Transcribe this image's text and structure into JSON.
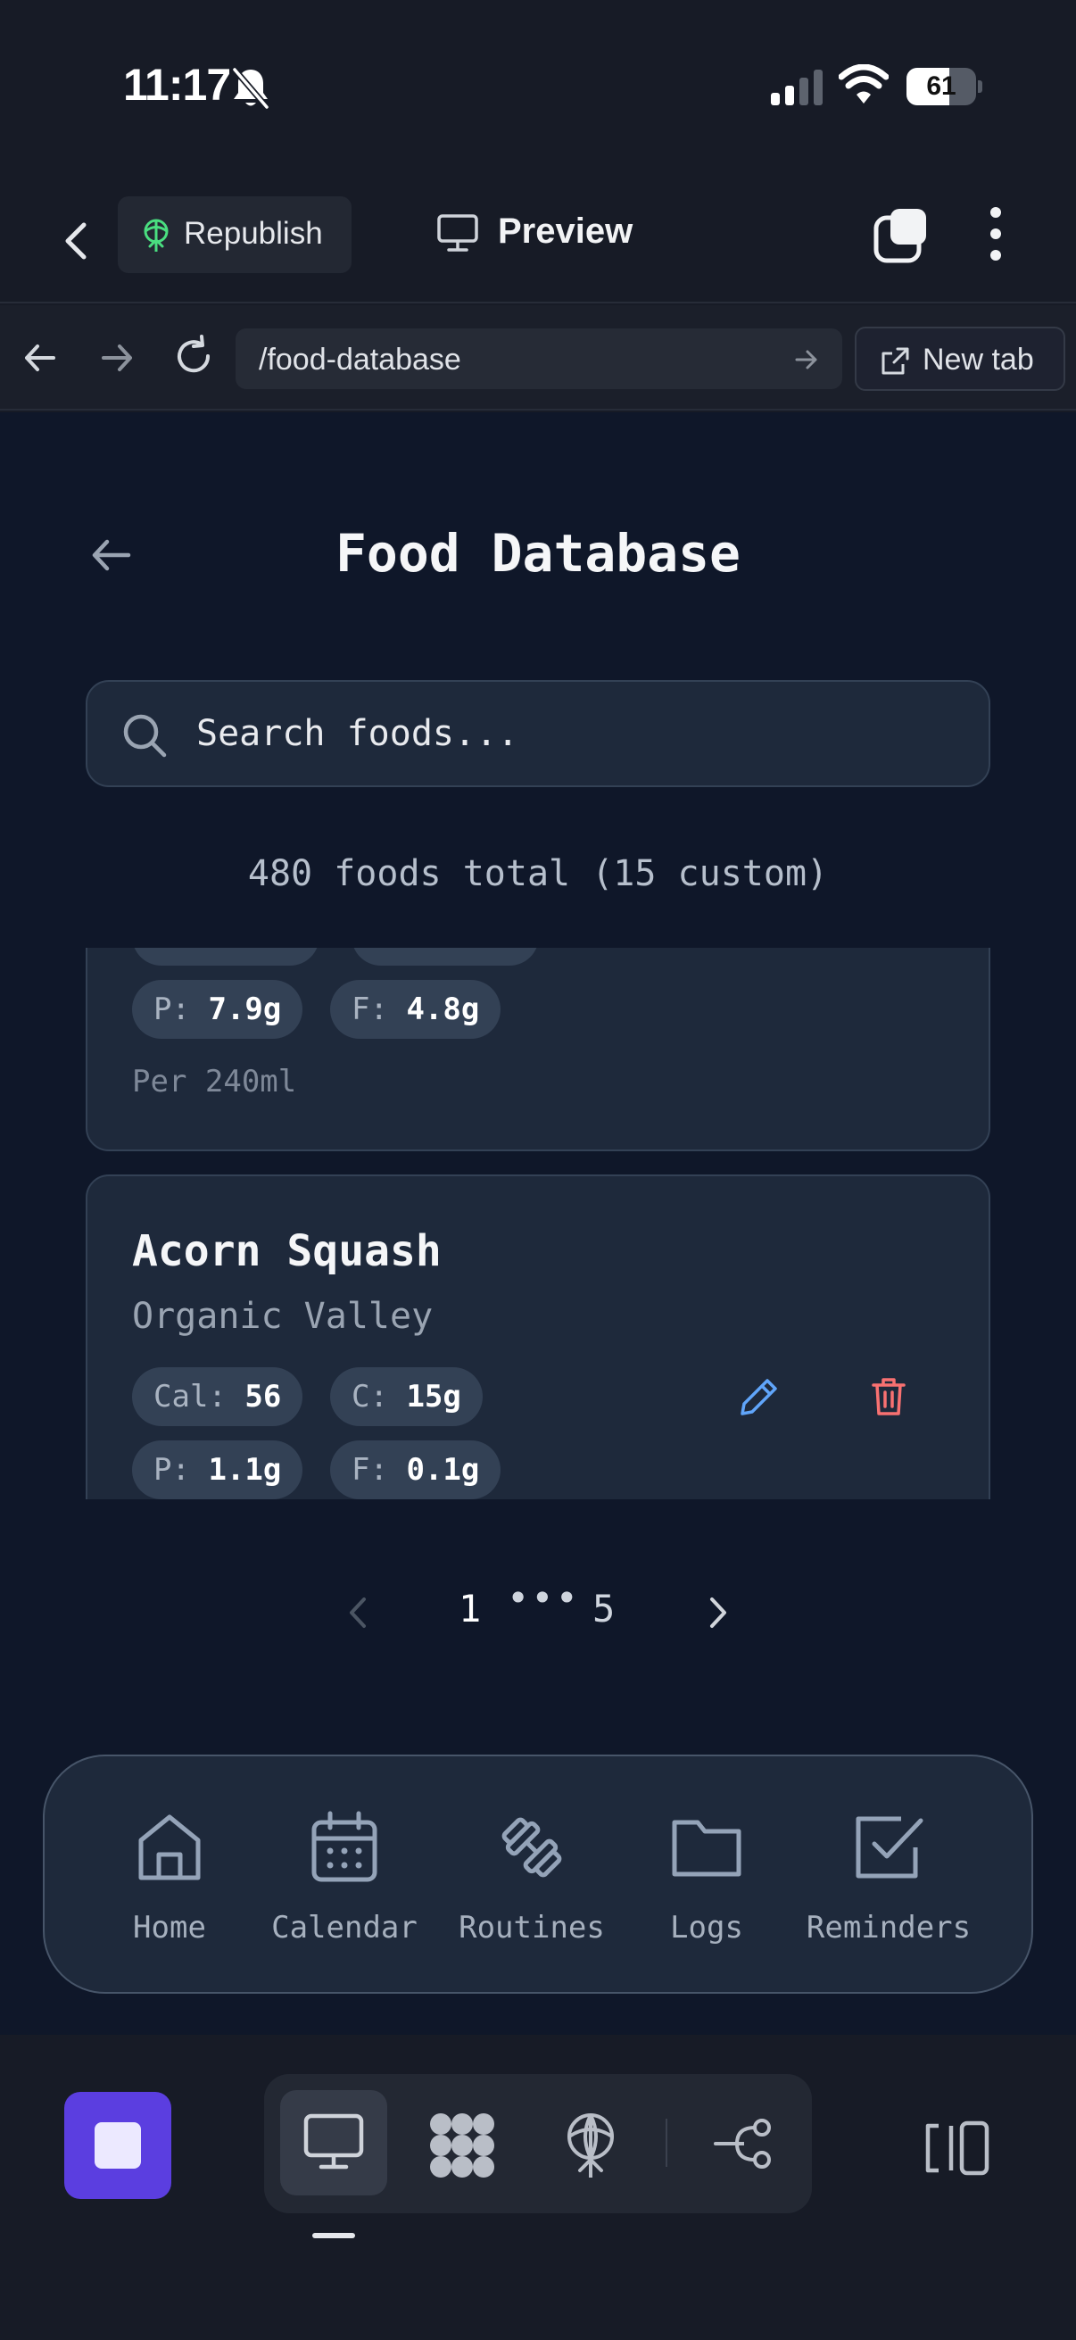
{
  "status_bar": {
    "time": "11:17",
    "battery_level": "61",
    "battery_fraction": 0.61,
    "icons": [
      "bell-off-icon",
      "signal-icon",
      "wifi-icon",
      "battery-icon"
    ]
  },
  "toolbar": {
    "republish_label": "Republish",
    "preview_label": "Preview",
    "icons": [
      "chevron-left-icon",
      "republish-icon",
      "monitor-icon",
      "tabs-icon",
      "more-vertical-icon"
    ]
  },
  "browser": {
    "url": "/food-database",
    "new_tab_label": "New tab",
    "icons": [
      "arrow-left-icon",
      "arrow-right-icon",
      "reload-icon",
      "external-link-icon"
    ]
  },
  "page": {
    "title": "Food Database",
    "search_placeholder": "Search foods...",
    "foods_count": "480 foods total (15 custom)"
  },
  "food_cards": [
    {
      "macros": [
        {
          "key": "P:",
          "value": "7.9g"
        },
        {
          "key": "F:",
          "value": "4.8g"
        }
      ],
      "per": "Per 240ml"
    },
    {
      "name": "Acorn Squash",
      "brand": "Organic Valley",
      "macros": [
        {
          "key": "Cal:",
          "value": "56"
        },
        {
          "key": "C:",
          "value": "15g"
        },
        {
          "key": "P:",
          "value": "1.1g"
        },
        {
          "key": "F:",
          "value": "0.1g"
        }
      ]
    }
  ],
  "pagination": {
    "current": "1",
    "ellipsis": "•••",
    "last": "5"
  },
  "bottom_nav": [
    {
      "label": "Home",
      "icon": "home-icon"
    },
    {
      "label": "Calendar",
      "icon": "calendar-icon"
    },
    {
      "label": "Routines",
      "icon": "dumbbell-icon"
    },
    {
      "label": "Logs",
      "icon": "folder-icon"
    },
    {
      "label": "Reminders",
      "icon": "checkbox-icon"
    }
  ],
  "colors": {
    "app_background": "#0f1729",
    "card_background": "#1e293b",
    "card_border": "#334155",
    "edit_accent": "#60a5fa",
    "delete_accent": "#f87171",
    "stop_button": "#5b3ee0",
    "republish_icon": "#4ade80"
  }
}
